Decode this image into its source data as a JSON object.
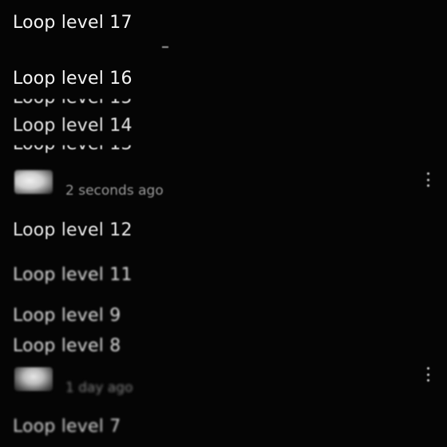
{
  "items": {
    "loop17": "Loop level 17",
    "loop16": "Loop level 16",
    "loop15": "Loop level 15",
    "loop14": "Loop level 14",
    "loop13": "Loop level 13",
    "loop12": "Loop level 12",
    "loop11": "Loop level 11",
    "loop9": "Loop level 9",
    "loop8": "Loop level 8",
    "loop7": "Loop level 7"
  },
  "messages": [
    {
      "time": "2 seconds ago",
      "icon": "more-vert-icon"
    },
    {
      "time": "1 day ago",
      "icon": "more-vert-icon"
    }
  ]
}
